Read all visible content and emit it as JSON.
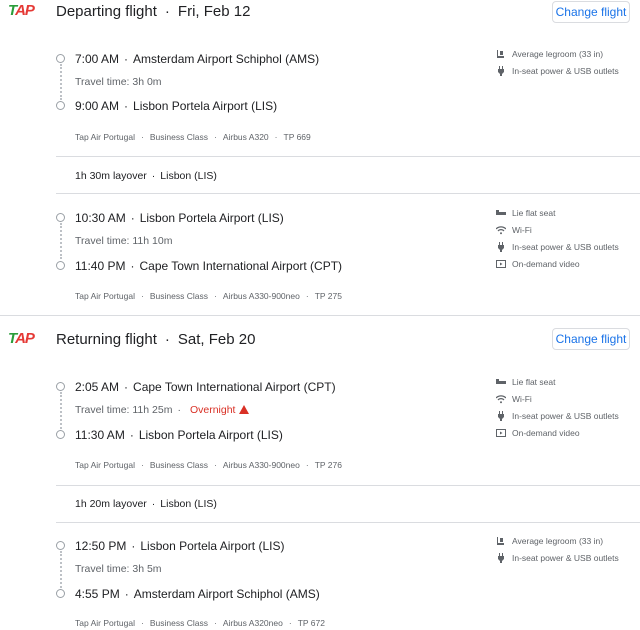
{
  "airline_logo": {
    "t": "T",
    "a": "A",
    "p": "P"
  },
  "change_label": "Change flight",
  "departing": {
    "title": "Departing flight",
    "date": "Fri, Feb 12",
    "seg1": {
      "dep_time": "7:00 AM",
      "dep_airport": "Amsterdam Airport Schiphol (AMS)",
      "travel": "Travel time: 3h 0m",
      "arr_time": "9:00 AM",
      "arr_airport": "Lisbon Portela Airport (LIS)",
      "airline": "Tap Air Portugal",
      "cabin": "Business Class",
      "aircraft": "Airbus A320",
      "flight": "TP 669",
      "amenities": [
        {
          "icon": "legroom-icon",
          "label": "Average legroom (33 in)"
        },
        {
          "icon": "power-plug-icon",
          "label": "In-seat power & USB outlets"
        }
      ]
    },
    "layover": {
      "duration": "1h 30m layover",
      "city": "Lisbon (LIS)"
    },
    "seg2": {
      "dep_time": "10:30 AM",
      "dep_airport": "Lisbon Portela Airport (LIS)",
      "travel": "Travel time: 11h 10m",
      "arr_time": "11:40 PM",
      "arr_airport": "Cape Town International Airport (CPT)",
      "airline": "Tap Air Portugal",
      "cabin": "Business Class",
      "aircraft": "Airbus A330-900neo",
      "flight": "TP 275",
      "amenities": [
        {
          "icon": "lie-flat-seat-icon",
          "label": "Lie flat seat"
        },
        {
          "icon": "wifi-icon",
          "label": "Wi-Fi"
        },
        {
          "icon": "power-plug-icon",
          "label": "In-seat power & USB outlets"
        },
        {
          "icon": "video-icon",
          "label": "On-demand video"
        }
      ]
    }
  },
  "returning": {
    "title": "Returning flight",
    "date": "Sat, Feb 20",
    "seg1": {
      "dep_time": "2:05 AM",
      "dep_airport": "Cape Town International Airport (CPT)",
      "travel": "Travel time: 11h 25m",
      "overnight": "Overnight",
      "arr_time": "11:30 AM",
      "arr_airport": "Lisbon Portela Airport (LIS)",
      "airline": "Tap Air Portugal",
      "cabin": "Business Class",
      "aircraft": "Airbus A330-900neo",
      "flight": "TP 276",
      "amenities": [
        {
          "icon": "lie-flat-seat-icon",
          "label": "Lie flat seat"
        },
        {
          "icon": "wifi-icon",
          "label": "Wi-Fi"
        },
        {
          "icon": "power-plug-icon",
          "label": "In-seat power & USB outlets"
        },
        {
          "icon": "video-icon",
          "label": "On-demand video"
        }
      ]
    },
    "layover": {
      "duration": "1h 20m layover",
      "city": "Lisbon (LIS)"
    },
    "seg2": {
      "dep_time": "12:50 PM",
      "dep_airport": "Lisbon Portela Airport (LIS)",
      "travel": "Travel time: 3h 5m",
      "arr_time": "4:55 PM",
      "arr_airport": "Amsterdam Airport Schiphol (AMS)",
      "airline": "Tap Air Portugal",
      "cabin": "Business Class",
      "aircraft": "Airbus A320neo",
      "flight": "TP 672",
      "amenities": [
        {
          "icon": "legroom-icon",
          "label": "Average legroom (33 in)"
        },
        {
          "icon": "power-plug-icon",
          "label": "In-seat power & USB outlets"
        }
      ]
    }
  }
}
